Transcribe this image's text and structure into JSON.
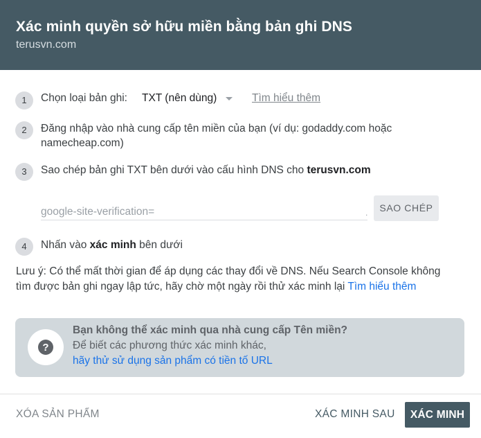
{
  "header": {
    "title": "Xác minh quyền sở hữu miền bằng bản ghi DNS",
    "subtitle": "terusvn.com"
  },
  "steps": [
    {
      "number": "1",
      "label": "Chọn loại bản ghi:",
      "select_value": "TXT (nên dùng)",
      "learn_more": "Tìm hiểu thêm"
    },
    {
      "number": "2",
      "text_line1": "Đăng nhập vào nhà cung cấp tên miền của bạn (ví dụ: godaddy.com hoặc",
      "text_line2": "namecheap.com)"
    },
    {
      "number": "3",
      "text": "Sao chép bản ghi TXT bên dưới vào cấu hình DNS cho ",
      "domain": "terusvn.com"
    },
    {
      "number": "4",
      "text_before": "Nhấn vào ",
      "bold": "xác minh",
      "text_after": " bên dưới"
    }
  ],
  "txt_record": {
    "value": "google-site-verification=",
    "copy_label": "SAO CHÉP"
  },
  "note": {
    "line1": "Lưu ý: Có thể mất thời gian để áp dụng các thay đổi về DNS. Nếu Search Console không",
    "line2": "tìm được bản ghi ngay lập tức, hãy chờ một ngày rồi thử xác minh lại ",
    "link": "Tìm hiểu thêm"
  },
  "hint": {
    "icon": "help-icon",
    "title": "Bạn không thể xác minh qua nhà cung cấp Tên miền?",
    "line": "Để biết các phương thức xác minh khác,",
    "link": "hãy thử sử dụng sản phẩm có tiền tố URL"
  },
  "footer": {
    "remove": "XÓA SẢN PHẨM",
    "later": "XÁC MINH SAU",
    "verify": "XÁC MINH"
  },
  "colors": {
    "header_bg": "#455a64",
    "link": "#1a73e8",
    "hint_bg": "#d1d8dc"
  }
}
